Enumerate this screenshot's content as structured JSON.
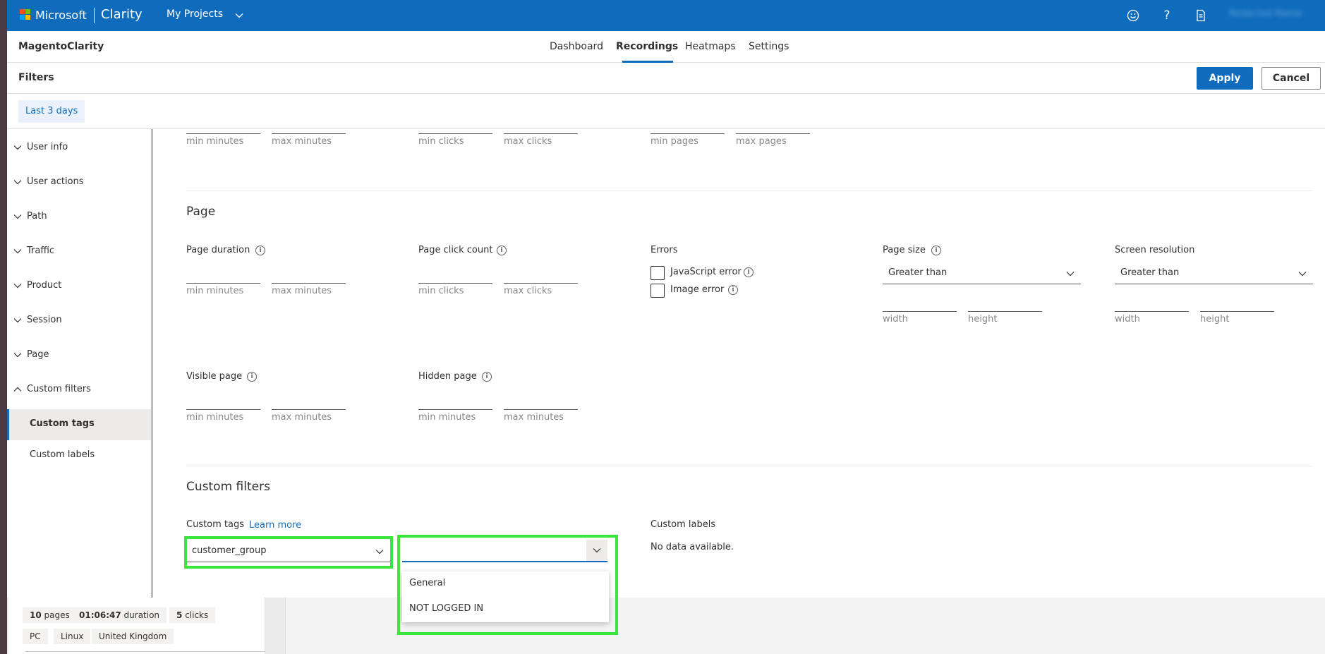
{
  "topbar": {
    "brand": "Microsoft",
    "product": "Clarity",
    "my_projects": "My Projects",
    "user_name": "Redacted Name",
    "colors": {
      "accent": "#0f6cbd",
      "logo_red": "#f25022",
      "logo_green": "#7fba00",
      "logo_blue": "#00a4ef",
      "logo_yellow": "#ffb900"
    },
    "icons": [
      "smiley-icon",
      "help-icon",
      "document-icon"
    ]
  },
  "project": {
    "name": "MagentoClarity",
    "tabs": [
      {
        "label": "Dashboard",
        "active": false
      },
      {
        "label": "Recordings",
        "active": true
      },
      {
        "label": "Heatmaps",
        "active": false
      },
      {
        "label": "Settings",
        "active": false
      }
    ]
  },
  "filters_bar": {
    "title": "Filters",
    "apply": "Apply",
    "cancel": "Cancel",
    "date_range": "Last 3 days"
  },
  "sidebar": {
    "items": [
      {
        "label": "User info",
        "expanded": false
      },
      {
        "label": "User actions",
        "expanded": false
      },
      {
        "label": "Path",
        "expanded": false
      },
      {
        "label": "Traffic",
        "expanded": false
      },
      {
        "label": "Product",
        "expanded": false
      },
      {
        "label": "Session",
        "expanded": false
      },
      {
        "label": "Page",
        "expanded": false
      },
      {
        "label": "Custom filters",
        "expanded": true
      }
    ],
    "subitems": [
      {
        "label": "Custom tags",
        "selected": true
      },
      {
        "label": "Custom labels",
        "selected": false
      }
    ]
  },
  "session_partial": {
    "min_minutes": "min minutes",
    "max_minutes": "max minutes",
    "min_clicks": "min clicks",
    "max_clicks": "max clicks",
    "min_pages": "min pages",
    "max_pages": "max pages"
  },
  "page_section": {
    "title": "Page",
    "page_duration": {
      "label": "Page duration",
      "min": "min minutes",
      "max": "max minutes"
    },
    "page_click_count": {
      "label": "Page click count",
      "min": "min clicks",
      "max": "max clicks"
    },
    "errors": {
      "label": "Errors",
      "options": [
        "JavaScript error",
        "Image error"
      ]
    },
    "page_size": {
      "label": "Page size",
      "selected": "Greater than",
      "width": "width",
      "height": "height"
    },
    "screen_resolution": {
      "label": "Screen resolution",
      "selected": "Greater than",
      "width": "width",
      "height": "height"
    },
    "visible_page": {
      "label": "Visible page",
      "min": "min minutes",
      "max": "max minutes"
    },
    "hidden_page": {
      "label": "Hidden page",
      "min": "min minutes",
      "max": "max minutes"
    }
  },
  "custom_filters": {
    "title": "Custom filters",
    "tags_label": "Custom tags",
    "learn_more": "Learn more",
    "tag_key_selected": "customer_group",
    "tag_value_selected": "",
    "tag_value_options": [
      "General",
      "NOT LOGGED IN"
    ],
    "labels_label": "Custom labels",
    "labels_empty": "No data available.",
    "highlight_color": "#39e63c"
  },
  "background_card": {
    "chips_row1": [
      {
        "value": "10",
        "text": "pages"
      },
      {
        "value": "01:06:47",
        "text": "duration"
      },
      {
        "value": "5",
        "text": "clicks"
      }
    ],
    "chips_row2": [
      "PC",
      "Linux",
      "United Kingdom"
    ]
  }
}
